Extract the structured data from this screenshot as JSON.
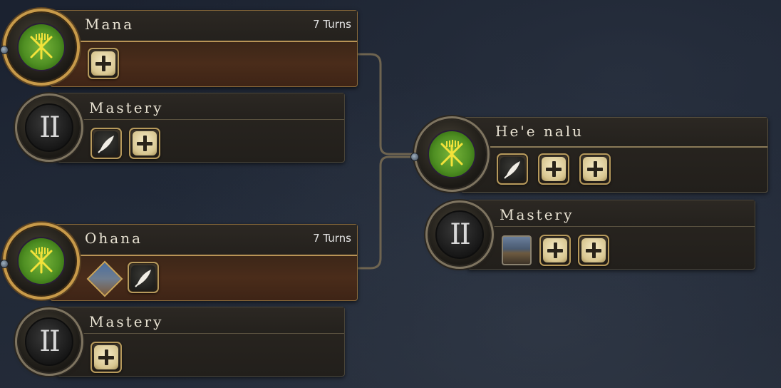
{
  "nodes": {
    "mana": {
      "title": "Mana",
      "turns": "7 Turns",
      "slots": [
        "plus-icon"
      ]
    },
    "mana_mastery": {
      "title": "Mastery",
      "level": "II",
      "slots": [
        "feather-icon",
        "plus-icon"
      ]
    },
    "ohana": {
      "title": "Ohana",
      "turns": "7 Turns",
      "slots": [
        "unit-diamond-icon",
        "feather-icon"
      ]
    },
    "ohana_mastery": {
      "title": "Mastery",
      "level": "II",
      "slots": [
        "plus-icon"
      ]
    },
    "heenalu": {
      "title": "He'e nalu",
      "slots": [
        "feather-icon",
        "plus-icon",
        "plus-icon"
      ]
    },
    "heenalu_mastery": {
      "title": "Mastery",
      "level": "II",
      "slots": [
        "building-icon",
        "plus-icon",
        "plus-icon"
      ]
    }
  },
  "colors": {
    "emblem_green": "#5aa02a",
    "emblem_purple": "#4a2e66",
    "gold_frame": "#c79a4a",
    "active_card": "#4a2c1a"
  }
}
